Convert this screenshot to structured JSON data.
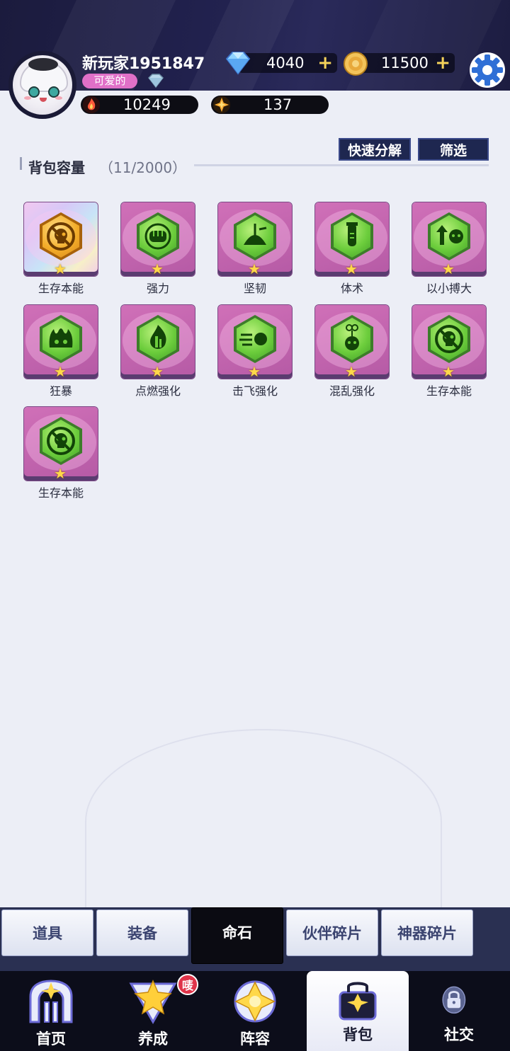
{
  "profile": {
    "username": "新玩家1951847",
    "title": "可爱的",
    "power": "10249",
    "energy": "137"
  },
  "currency": {
    "diamonds": "4040",
    "coins": "11500"
  },
  "toolbar": {
    "quick_decompose": "快速分解",
    "filter": "筛选"
  },
  "bag": {
    "capacity_label": "背包容量",
    "capacity_count": "（11/2000）"
  },
  "items": [
    {
      "name": "生存本能",
      "rarity": "gold",
      "icon": "skull-crossed-icon"
    },
    {
      "name": "强力",
      "rarity": "green",
      "icon": "fist-icon"
    },
    {
      "name": "坚韧",
      "rarity": "green",
      "icon": "sprout-shield-icon"
    },
    {
      "name": "体术",
      "rarity": "green",
      "icon": "potion-vial-icon"
    },
    {
      "name": "以小搏大",
      "rarity": "green",
      "icon": "arrow-vs-enemy-icon"
    },
    {
      "name": "狂暴",
      "rarity": "green",
      "icon": "rage-flame-face-icon"
    },
    {
      "name": "点燃强化",
      "rarity": "green",
      "icon": "fire-icon"
    },
    {
      "name": "击飞强化",
      "rarity": "green",
      "icon": "knockback-icon"
    },
    {
      "name": "混乱强化",
      "rarity": "green",
      "icon": "confusion-icon"
    },
    {
      "name": "生存本能",
      "rarity": "green",
      "icon": "skull-crossed-icon"
    },
    {
      "name": "生存本能",
      "rarity": "green",
      "icon": "skull-crossed-icon"
    }
  ],
  "tabs": [
    {
      "label": "道具",
      "active": false
    },
    {
      "label": "装备",
      "active": false
    },
    {
      "label": "命石",
      "active": true
    },
    {
      "label": "伙伴碎片",
      "active": false
    },
    {
      "label": "神器碎片",
      "active": false
    }
  ],
  "nav": [
    {
      "label": "首页",
      "icon": "home-gate-icon"
    },
    {
      "label": "养成",
      "icon": "star-triangle-icon"
    },
    {
      "label": "阵容",
      "icon": "star-badge-icon"
    },
    {
      "label": "背包",
      "icon": "bag-icon",
      "active": true
    },
    {
      "label": "社交",
      "icon": "lock-icon",
      "locked": true
    }
  ],
  "nav_badge": "唛",
  "colors": {
    "card_purple": "#c866b0",
    "header_dark": "#1b1b3d",
    "tab_active": "#0b0b12",
    "gold_star": "#ffd84a"
  }
}
